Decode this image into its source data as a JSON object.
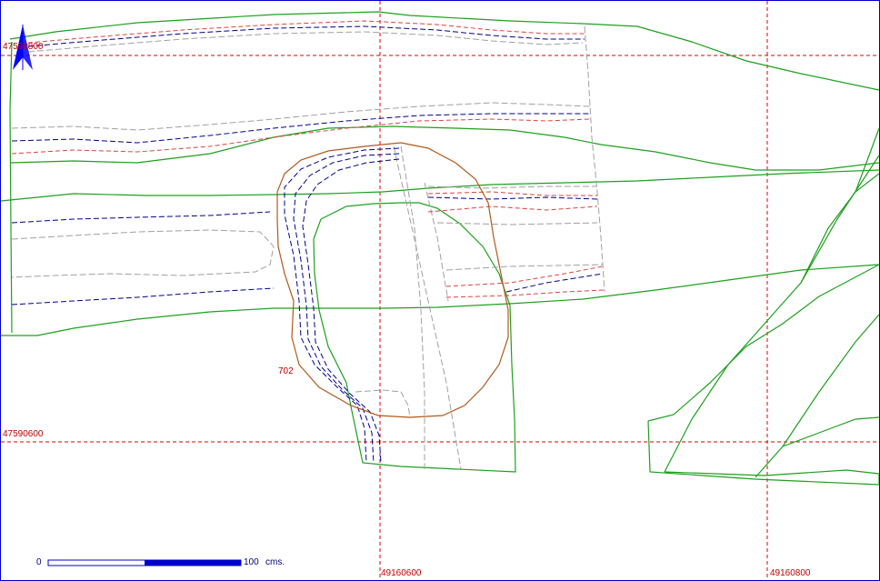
{
  "grid": {
    "northing_labels": [
      "47590800",
      "47590600"
    ],
    "easting_labels": [
      "49160600",
      "49160800"
    ]
  },
  "parcel_label": "702",
  "scale_bar": {
    "min_label": "0",
    "max_label": "100",
    "unit_label": "cms."
  },
  "colors": {
    "grid": "#e00000",
    "boundary": "#1ea01e",
    "contour_blue": "#00008b",
    "contour_red": "#e04040",
    "contour_gray": "#a0a0a0",
    "outline_brown": "#b05a1e",
    "north_arrow": "#0000ff"
  },
  "icons": {
    "north_arrow": "north-arrow-icon"
  }
}
